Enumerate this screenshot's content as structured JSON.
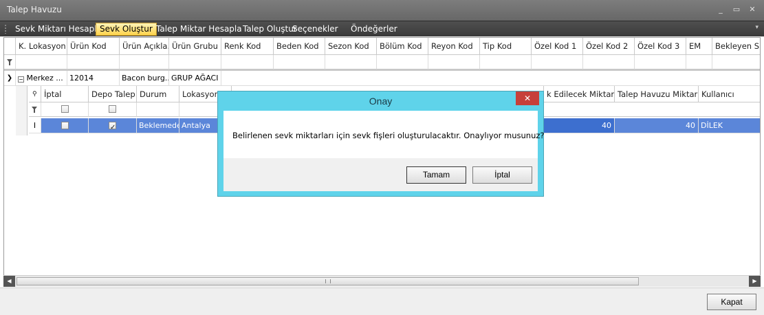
{
  "window": {
    "title": "Talep Havuzu"
  },
  "menu": {
    "items": [
      {
        "label": "Sevk Miktarı Hesapla",
        "active": false
      },
      {
        "label": "Sevk Oluştur",
        "active": true
      },
      {
        "label": "Talep Miktar Hesapla",
        "active": false
      },
      {
        "label": "Talep Oluştur",
        "active": false
      },
      {
        "label": "Seçenekler",
        "active": false
      },
      {
        "label": "Öndeğerler",
        "active": false
      }
    ]
  },
  "main_grid": {
    "columns": [
      "K. Lokasyon",
      "Ürün Kod",
      "Ürün Açıkla...",
      "Ürün Grubu",
      "Renk Kod",
      "Beden Kod",
      "Sezon Kod",
      "Bölüm Kod",
      "Reyon Kod",
      "Tip Kod",
      "Özel Kod 1",
      "Özel Kod 2",
      "Özel Kod 3",
      "EM",
      "Bekleyen Sipa"
    ],
    "row": {
      "lokasyon": "Merkez ...",
      "urun_kod": "12014",
      "urun_aciklama": "Bacon burg...",
      "urun_grubu": "GRUP AĞACI"
    }
  },
  "detail_grid": {
    "columns": [
      "İptal",
      "Depo Talep",
      "Durum",
      "Lokasyon",
      "k Edilecek Miktar",
      "Talep Havuzu Miktar",
      "Kullanıcı"
    ],
    "row": {
      "iptal": false,
      "depo_talep": true,
      "durum": "Beklemede",
      "lokasyon": "Antalya",
      "sevk_miktar": "40",
      "talep_havuzu_miktar": "40",
      "kullanici": "DİLEK"
    }
  },
  "dialog": {
    "title": "Onay",
    "message": "Belirlenen sevk miktarları için sevk fişleri oluşturulacaktır. Onaylıyor musunuz?",
    "ok_label": "Tamam",
    "cancel_label": "İptal"
  },
  "footer": {
    "close_label": "Kapat"
  },
  "colors": {
    "selection": "#5b86d9",
    "dialog_frame": "#5fd3ea",
    "menu_active": "#ffd24a",
    "close_red": "#c7403a"
  }
}
